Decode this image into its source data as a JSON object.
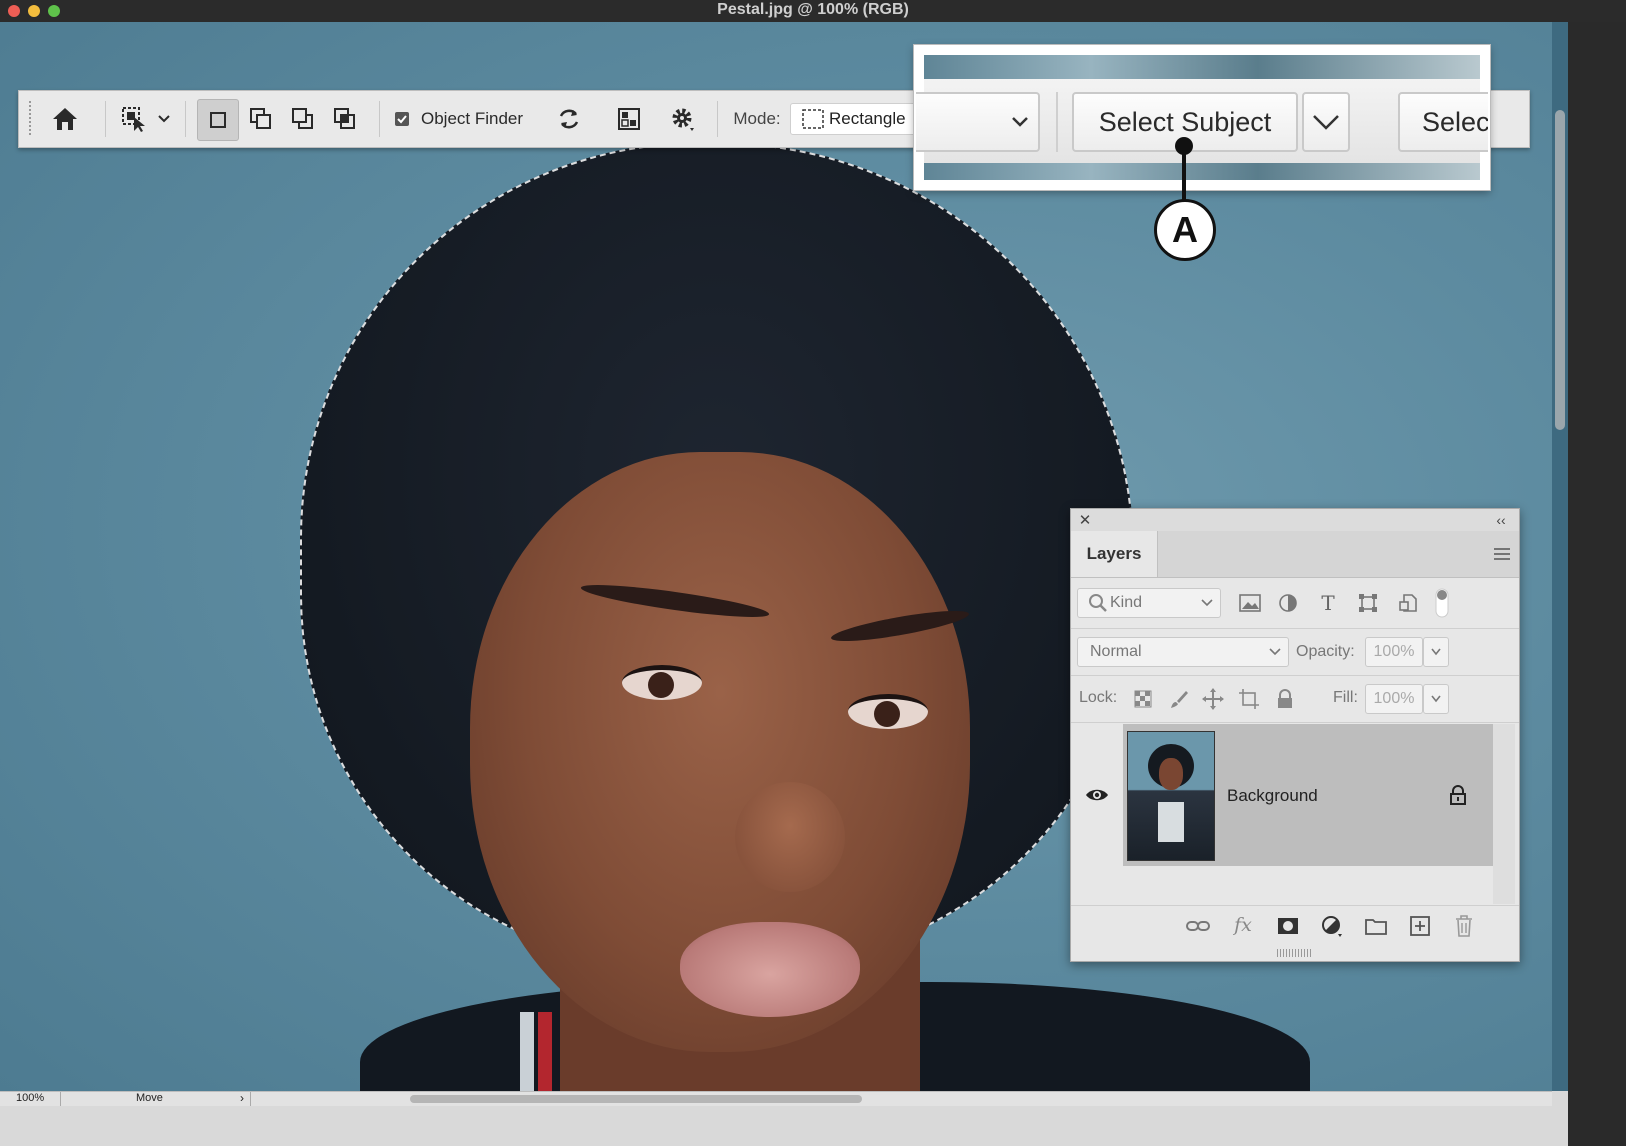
{
  "window": {
    "title": "Pestal.jpg @ 100% (RGB)"
  },
  "toolbar": {
    "object_finder_label": "Object Finder",
    "object_finder_checked": true,
    "mode_label": "Mode:",
    "mode_value": "Rectangle"
  },
  "zoom_callout": {
    "select_subject_label": "Select Subject",
    "partial_button_label": "Selec",
    "callout_letter": "A"
  },
  "layers_panel": {
    "tab_label": "Layers",
    "filter_placeholder": "Kind",
    "blend_mode": "Normal",
    "opacity_label": "Opacity:",
    "opacity_value": "100%",
    "lock_label": "Lock:",
    "fill_label": "Fill:",
    "fill_value": "100%",
    "layers": [
      {
        "name": "Background",
        "visible": true,
        "locked": true
      }
    ]
  },
  "status_bar": {
    "zoom": "100%",
    "tool": "Move"
  },
  "icons": {
    "home": "home-icon",
    "select": "object-selection-icon",
    "settings": "gear-icon",
    "refresh": "refresh-icon",
    "visibility": "eye-icon",
    "lock": "lock-icon"
  },
  "colors": {
    "accent_callout": "#111111",
    "canvas_bg": "#5d8ba0"
  }
}
